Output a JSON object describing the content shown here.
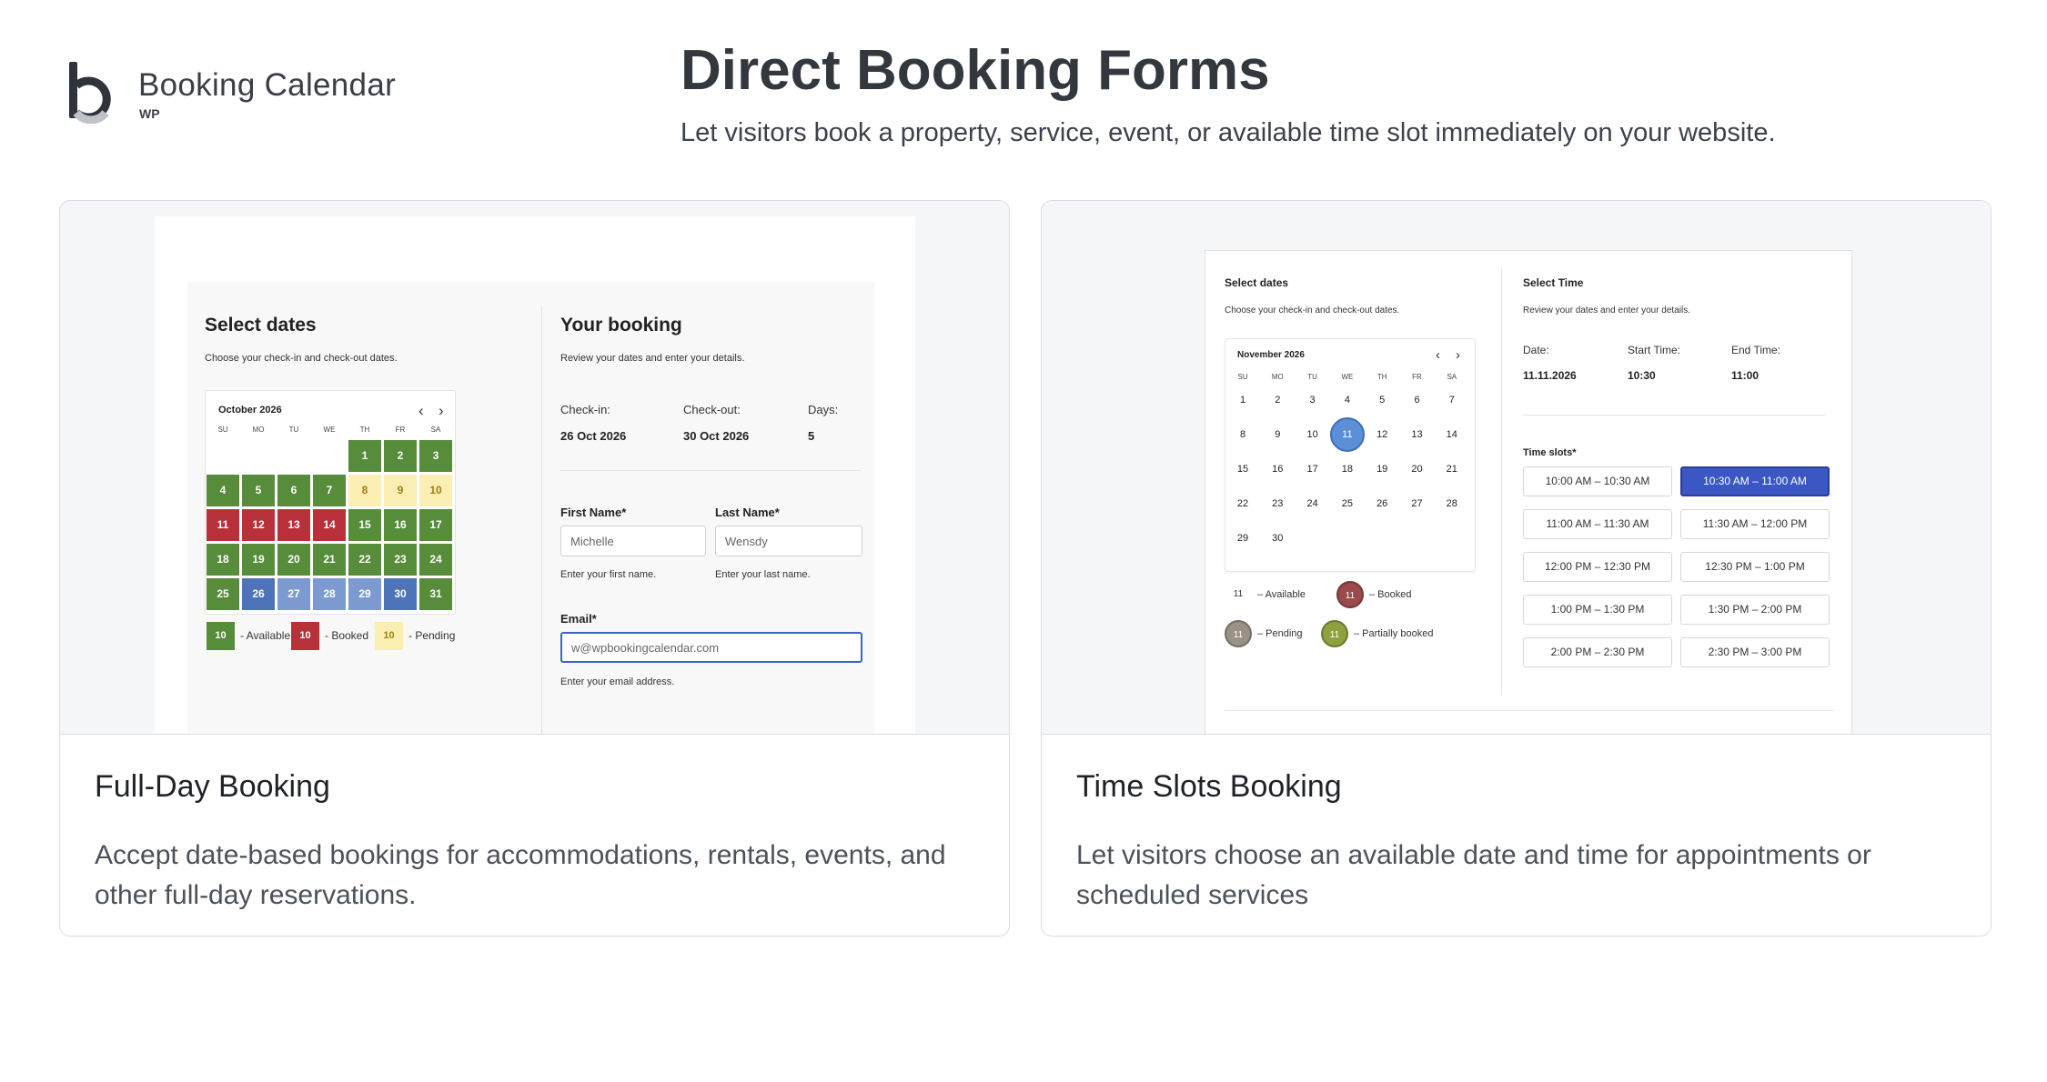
{
  "header": {
    "brand_name": "Booking Calendar",
    "brand_sub": "WP",
    "title": "Direct Booking Forms",
    "subtitle": "Let visitors book a property, service, event, or available time slot immediately on your website."
  },
  "colors": {
    "available": "#568c3a",
    "booked": "#b8313a",
    "pending": "#fbeeb3",
    "pending_text": "#9c7f1a",
    "selected_light": "#7d9ad0",
    "selected_dark": "#4d74b8",
    "slot_selected": "#3a57c4"
  },
  "cards": [
    {
      "title": "Full-Day Booking",
      "description": "Accept date-based bookings for accommodations, rentals, events, and other full-day reservations.",
      "preview": {
        "select_dates_title": "Select dates",
        "select_dates_sub": "Choose your check-in and check-out dates.",
        "calendar_month": "October 2026",
        "prev": "‹",
        "next": "›",
        "weekdays": [
          "SU",
          "MO",
          "TU",
          "WE",
          "TH",
          "FR",
          "SA"
        ],
        "your_booking_title": "Your booking",
        "your_booking_sub": "Review your dates and enter your details.",
        "checkin_label": "Check-in:",
        "checkin_value": "26 Oct 2026",
        "checkout_label": "Check-out:",
        "checkout_value": "30 Oct 2026",
        "days_label": "Days:",
        "days_value": "5",
        "first_name_label": "First Name*",
        "first_name_value": "Michelle",
        "first_name_help": "Enter your first name.",
        "last_name_label": "Last Name*",
        "last_name_value": "Wensdy",
        "last_name_help": "Enter your last name.",
        "email_label": "Email*",
        "email_value": "w@wpbookingcalendar.com",
        "email_help": "Enter your email address.",
        "legend": [
          {
            "num": "10",
            "text": "- Available",
            "state": "available"
          },
          {
            "num": "10",
            "text": "- Booked",
            "state": "booked"
          },
          {
            "num": "10",
            "text": "- Pending",
            "state": "pending"
          }
        ]
      }
    },
    {
      "title": "Time Slots Booking",
      "description": "Let visitors choose an available date and time for appointments or scheduled services",
      "preview": {
        "select_dates_title": "Select dates",
        "select_dates_sub": "Choose your check-in and check-out dates.",
        "calendar_month": "November 2026",
        "prev": "‹",
        "next": "›",
        "weekdays": [
          "SU",
          "MO",
          "TU",
          "WE",
          "TH",
          "FR",
          "SA"
        ],
        "selected_day": "11",
        "select_time_title": "Select Time",
        "select_time_sub": "Review your dates and enter your details.",
        "date_label": "Date:",
        "date_value": "11.11.2026",
        "start_label": "Start Time:",
        "start_value": "10:30",
        "end_label": "End Time:",
        "end_value": "11:00",
        "slots_label": "Time slots*",
        "slots": [
          "10:00 AM – 10:30 AM",
          "10:30 AM – 11:00 AM",
          "11:00 AM – 11:30 AM",
          "11:30 AM – 12:00 PM",
          "12:00 PM – 12:30 PM",
          "12:30 PM – 1:00 PM",
          "1:00 PM – 1:30 PM",
          "1:30 PM – 2:00 PM",
          "2:00 PM – 2:30 PM",
          "2:30 PM – 3:00 PM"
        ],
        "selected_slot": 1,
        "legend": [
          {
            "num": "11",
            "text": "– Available",
            "state": "available"
          },
          {
            "num": "11",
            "text": "– Booked",
            "state": "booked"
          },
          {
            "num": "11",
            "text": "– Pending",
            "state": "pending"
          },
          {
            "num": "11",
            "text": "– Partially booked",
            "state": "partial"
          }
        ]
      }
    }
  ],
  "calendar_left": {
    "weeks": [
      [
        null,
        null,
        null,
        null,
        {
          "d": "1",
          "s": "a"
        },
        {
          "d": "2",
          "s": "a"
        },
        {
          "d": "3",
          "s": "a"
        }
      ],
      [
        {
          "d": "4",
          "s": "a"
        },
        {
          "d": "5",
          "s": "a"
        },
        {
          "d": "6",
          "s": "a"
        },
        {
          "d": "7",
          "s": "a"
        },
        {
          "d": "8",
          "s": "p"
        },
        {
          "d": "9",
          "s": "p"
        },
        {
          "d": "10",
          "s": "p"
        }
      ],
      [
        {
          "d": "11",
          "s": "b"
        },
        {
          "d": "12",
          "s": "b"
        },
        {
          "d": "13",
          "s": "b"
        },
        {
          "d": "14",
          "s": "b"
        },
        {
          "d": "15",
          "s": "a"
        },
        {
          "d": "16",
          "s": "a"
        },
        {
          "d": "17",
          "s": "a"
        }
      ],
      [
        {
          "d": "18",
          "s": "a"
        },
        {
          "d": "19",
          "s": "a"
        },
        {
          "d": "20",
          "s": "a"
        },
        {
          "d": "21",
          "s": "a"
        },
        {
          "d": "22",
          "s": "a"
        },
        {
          "d": "23",
          "s": "a"
        },
        {
          "d": "24",
          "s": "a"
        }
      ],
      [
        {
          "d": "25",
          "s": "a"
        },
        {
          "d": "26",
          "s": "sd"
        },
        {
          "d": "27",
          "s": "sl"
        },
        {
          "d": "28",
          "s": "sl"
        },
        {
          "d": "29",
          "s": "sl"
        },
        {
          "d": "30",
          "s": "sd"
        },
        {
          "d": "31",
          "s": "a"
        }
      ]
    ]
  },
  "calendar_right": {
    "weeks": [
      [
        "1",
        "2",
        "3",
        "4",
        "5",
        "6",
        "7"
      ],
      [
        "8",
        "9",
        "10",
        "11",
        "12",
        "13",
        "14"
      ],
      [
        "15",
        "16",
        "17",
        "18",
        "19",
        "20",
        "21"
      ],
      [
        "22",
        "23",
        "24",
        "25",
        "26",
        "27",
        "28"
      ],
      [
        "29",
        "30"
      ]
    ]
  }
}
